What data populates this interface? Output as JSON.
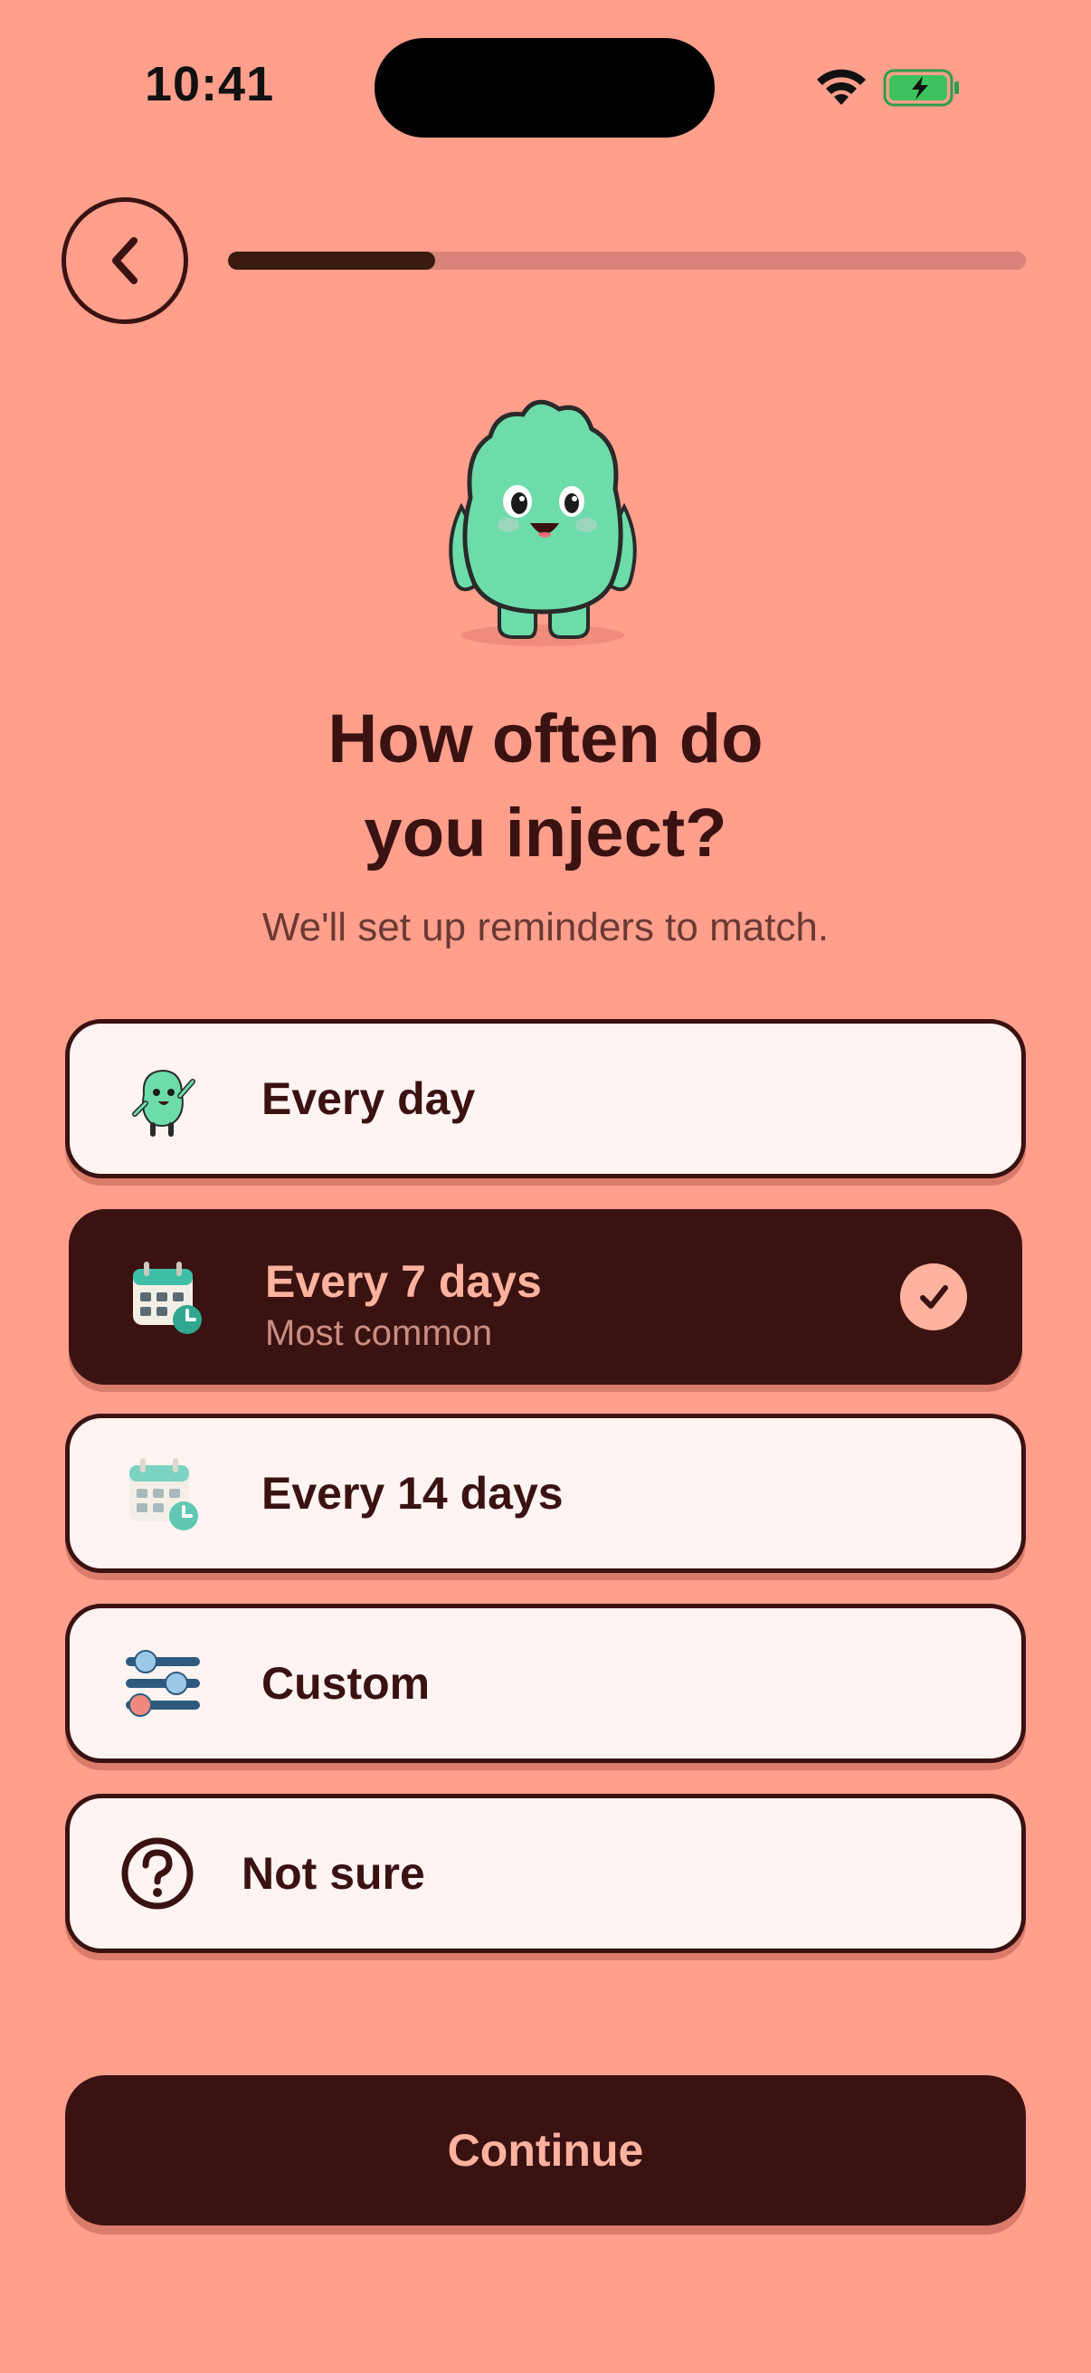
{
  "status_bar": {
    "time": "10:41"
  },
  "onboarding": {
    "progress_fraction": 0.26
  },
  "question": {
    "title_line1": "How often do",
    "title_line2": "you inject?",
    "subtitle": "We'll set up reminders to match."
  },
  "options": [
    {
      "label": "Every day",
      "icon": "mascot-waving-icon",
      "selected": false
    },
    {
      "label": "Every 7 days",
      "sublabel": "Most common",
      "icon": "calendar-clock-icon",
      "selected": true
    },
    {
      "label": "Every 14 days",
      "icon": "calendar-clock-icon",
      "selected": false
    },
    {
      "label": "Custom",
      "icon": "sliders-icon",
      "selected": false
    },
    {
      "label": "Not sure",
      "icon": "question-circle-icon",
      "selected": false
    }
  ],
  "continue_label": "Continue",
  "colors": {
    "background": "#FF9F8C",
    "dark": "#3A1212",
    "accent": "#FFB29E",
    "card": "#FFF4F1",
    "mascot": "#6DDCAA"
  }
}
